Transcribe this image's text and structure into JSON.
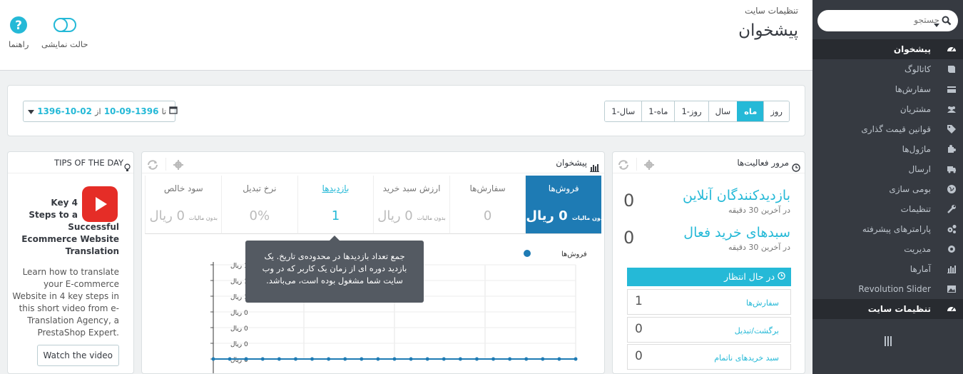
{
  "sidebar": {
    "search_placeholder": "جستجو",
    "items": [
      {
        "label": "پیشخوان",
        "icon": "dashboard-icon",
        "active": true
      },
      {
        "label": "کاتالوگ",
        "icon": "book-icon"
      },
      {
        "label": "سفارش‌ها",
        "icon": "credit-card-icon"
      },
      {
        "label": "مشتریان",
        "icon": "users-icon"
      },
      {
        "label": "قوانین قیمت گذاری",
        "icon": "tag-icon"
      },
      {
        "label": "ماژول‌ها",
        "icon": "puzzle-icon"
      },
      {
        "label": "ارسال",
        "icon": "truck-icon"
      },
      {
        "label": "بومی سازی",
        "icon": "globe-icon"
      },
      {
        "label": "تنظیمات",
        "icon": "wrench-icon"
      },
      {
        "label": "پارامترهای پیشرفته",
        "icon": "cogs-icon"
      },
      {
        "label": "مدیریت",
        "icon": "gear-icon"
      },
      {
        "label": "آمارها",
        "icon": "bar-chart-icon"
      },
      {
        "label": "Revolution Slider",
        "icon": "image-icon"
      },
      {
        "label": "تنظیمات سایت",
        "icon": "dashboard-icon",
        "active": true
      }
    ]
  },
  "header": {
    "breadcrumb": "تنظیمات سایت",
    "title": "پیشخوان",
    "help_label": "راهنما",
    "demo_label": "حالت نمایشی"
  },
  "datebar": {
    "from_prefix": "از",
    "from": "1396-09-10",
    "to_prefix": "تا",
    "to": "1396-10-02",
    "periods": [
      "روز",
      "ماه",
      "سال",
      "روز-1",
      "ماه-1",
      "سال-1"
    ],
    "selected_period": "ماه"
  },
  "tips": {
    "title": "TIPS OF THE DAY",
    "video_title": "Key 4 Steps to a Successful Ecommerce Website Translation",
    "video_title_lines": [
      "Key 4",
      "Steps to a",
      "Successful",
      "Ecommerce Website",
      "Translation"
    ],
    "description": "Learn how to translate your E-commerce Website in 4 key steps in this short video from e-Translation Agency, a PrestaShop Expert.",
    "button": "Watch the video"
  },
  "dashboard": {
    "title": "پیشخوان",
    "kpis": [
      {
        "label": "فروش‌ها",
        "value": "0 ریال",
        "tax": "بدون مالیات",
        "selected": true
      },
      {
        "label": "سفارش‌ها",
        "value": "0"
      },
      {
        "label": "ارزش سبد خرید",
        "value": "0 ریال",
        "tax": "بدون مالیات"
      },
      {
        "label": "بازدیدها",
        "value": "1",
        "link": true
      },
      {
        "label": "نرخ تبدیل",
        "value": "0%"
      },
      {
        "label": "سود خالص",
        "value": "0 ریال",
        "tax": "بدون مالیات"
      }
    ],
    "tooltip": "جمع تعداد بازدیدها در محدوده‌ی تاریخ. یک بازدید دوره ای از زمان یک کاربر که در وب سایت شما مشغول بوده است، می‌باشد."
  },
  "chart_data": {
    "type": "line",
    "series": [
      {
        "name": "فروش‌ها",
        "values": [
          0,
          0,
          0,
          0,
          0,
          0,
          0,
          0,
          0,
          0,
          0,
          0,
          0,
          0,
          0,
          0,
          0,
          0,
          0,
          0,
          0,
          0,
          0
        ]
      }
    ],
    "y_ticks": [
      "1 ریال",
      "1 ریال",
      "1 ریال",
      "0 ریال",
      "0 ریال",
      "0 ریال",
      "0 ریال"
    ],
    "legend": "top-right",
    "color": "#1e7bb4"
  },
  "activity": {
    "title": "مرور فعالیت‌ها",
    "online_label": "بازدیدکنندگان آنلاین",
    "online_value": "0",
    "online_sub": "در آخرین 30 دقیقه",
    "carts_label": "سبدهای خرید فعال",
    "carts_value": "0",
    "carts_sub": "در آخرین 30 دقیقه",
    "pending_title": "در حال انتظار",
    "pending": [
      {
        "label": "سفارش‌ها",
        "value": "1"
      },
      {
        "label": "برگشت/تبدیل",
        "value": "0"
      },
      {
        "label": "سبد خریدهای ناتمام",
        "value": "0"
      }
    ]
  }
}
